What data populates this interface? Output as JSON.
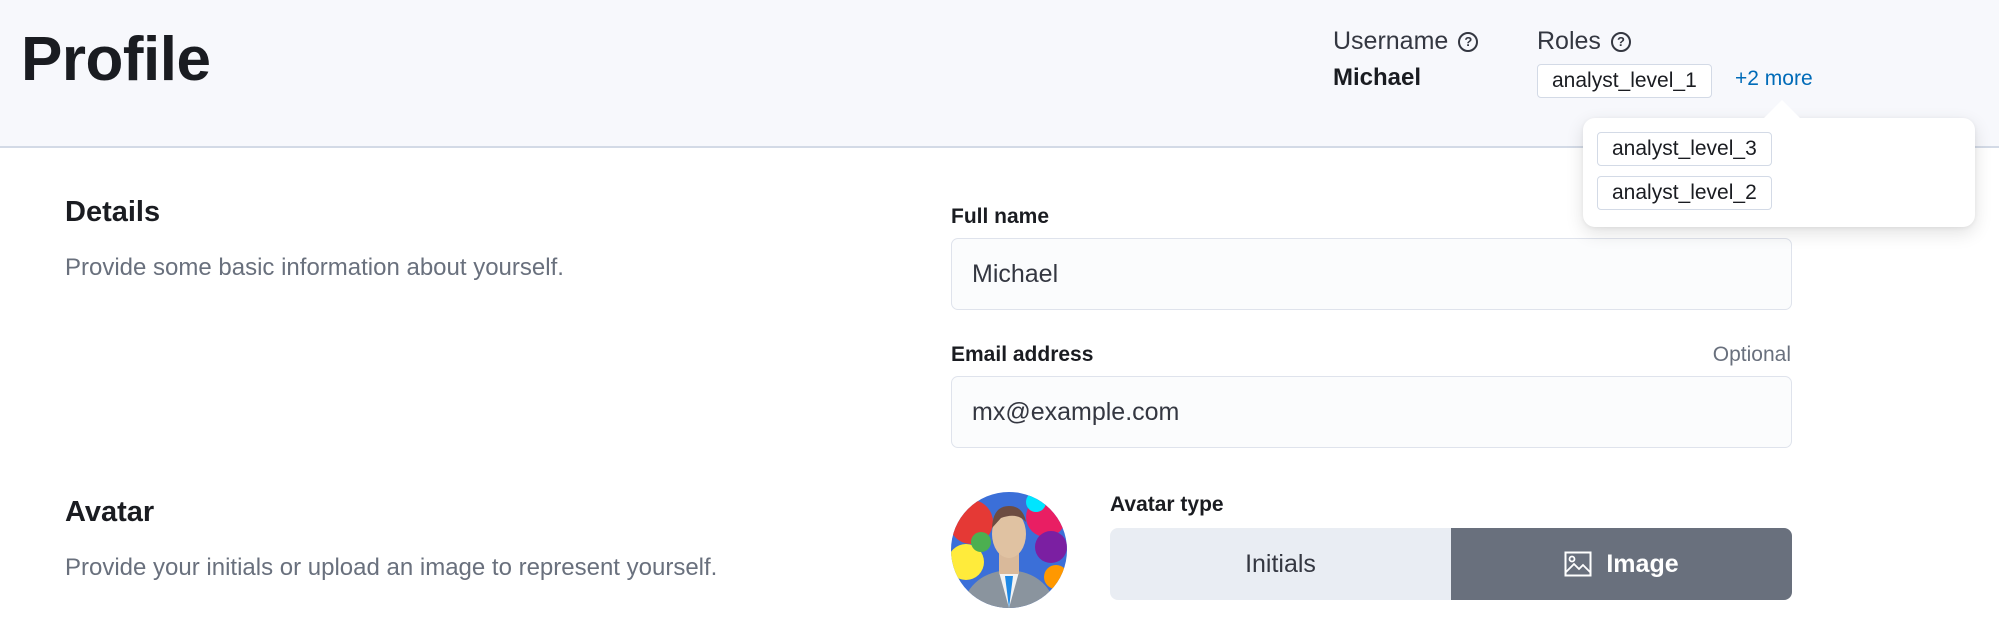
{
  "header": {
    "title": "Profile",
    "username_label": "Username",
    "username_value": "Michael",
    "roles_label": "Roles",
    "roles_visible": [
      "analyst_level_1"
    ],
    "more_link": "+2 more"
  },
  "roles_popover": {
    "roles": [
      "analyst_level_3",
      "analyst_level_2"
    ]
  },
  "details": {
    "title": "Details",
    "description": "Provide some basic information about yourself.",
    "full_name_label": "Full name",
    "full_name_value": "Michael",
    "email_label": "Email address",
    "email_optional": "Optional",
    "email_value": "mx@example.com"
  },
  "avatar": {
    "title": "Avatar",
    "description": "Provide your initials or upload an image to represent yourself.",
    "type_label": "Avatar type",
    "options": [
      "Initials",
      "Image"
    ],
    "selected": "Image"
  },
  "icons": {
    "help": "?"
  },
  "colors": {
    "link": "#006bb8",
    "selected_segment": "#69707d",
    "unselected_segment": "#e9edf3"
  }
}
